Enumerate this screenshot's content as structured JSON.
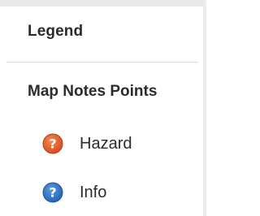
{
  "panel": {
    "title": "Legend"
  },
  "layer": {
    "title": "Map Notes Points",
    "items": [
      {
        "label": "Hazard",
        "icon": "question-mark-icon",
        "color": "#e0592a"
      },
      {
        "label": "Info",
        "icon": "question-mark-icon",
        "color": "#2f6fc0"
      }
    ]
  }
}
